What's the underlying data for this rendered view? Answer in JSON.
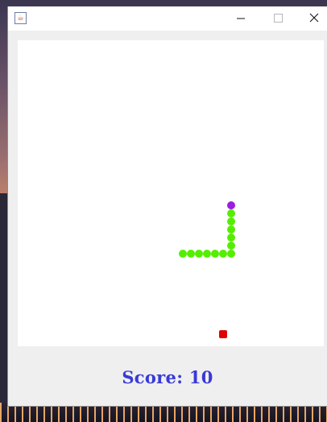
{
  "window": {
    "icon": "java-cup-icon"
  },
  "titlebar_controls": {
    "minimize_icon": "minimize-icon",
    "maximize_icon": "maximize-icon",
    "close_icon": "close-icon"
  },
  "game": {
    "snake_color": "#55ee00",
    "head_color": "#9b1de0",
    "food_color": "#e00000",
    "board_color": "#ffffff",
    "cell_units": 10,
    "snake_head": [
      26,
      20
    ],
    "snake_body": [
      [
        26,
        21
      ],
      [
        26,
        22
      ],
      [
        26,
        23
      ],
      [
        26,
        24
      ],
      [
        26,
        25
      ],
      [
        26,
        26
      ],
      [
        25,
        26
      ],
      [
        24,
        26
      ],
      [
        23,
        26
      ],
      [
        22,
        26
      ],
      [
        21,
        26
      ],
      [
        20,
        26
      ]
    ],
    "food": [
      25,
      36
    ]
  },
  "score": {
    "text": "Score: 10",
    "color": "#3a3ad6"
  }
}
